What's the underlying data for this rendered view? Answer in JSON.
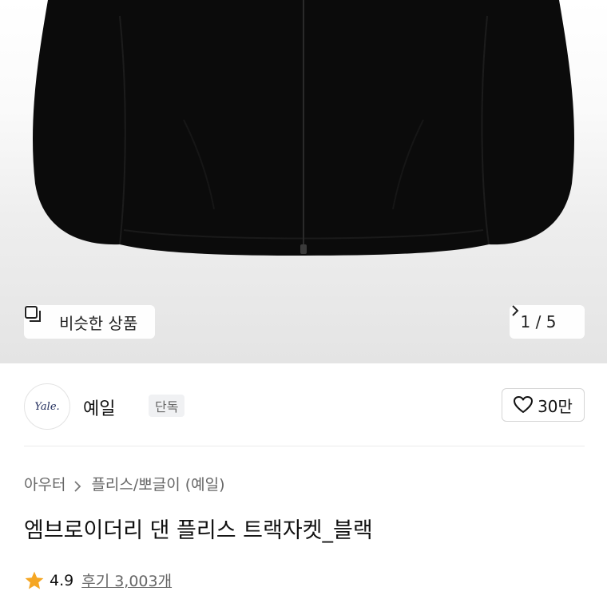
{
  "hero": {
    "similar_button_label": "비슷한 상품",
    "pager_text": "1 / 5"
  },
  "brand": {
    "logo_text": "Yale.",
    "name": "예일",
    "badge": "단독",
    "likes": "30만"
  },
  "breadcrumb": {
    "level1": "아우터",
    "level2": "플리스/뽀글이 (예일)"
  },
  "product": {
    "title": "엠브로이더리 댄 플리스 트랙자켓_블랙",
    "rating": "4.9",
    "review_label": "후기 3,003개"
  },
  "colors": {
    "star": "#f5a623",
    "jacket": "#0b0b0b",
    "badge_bg": "#f0f1f3"
  },
  "icons": {
    "similar": "similar-items-icon",
    "pager_next": "chevron-right-icon",
    "like": "heart-outline-icon",
    "breadcrumb_sep": "chevron-right-icon",
    "rating": "star-icon"
  }
}
